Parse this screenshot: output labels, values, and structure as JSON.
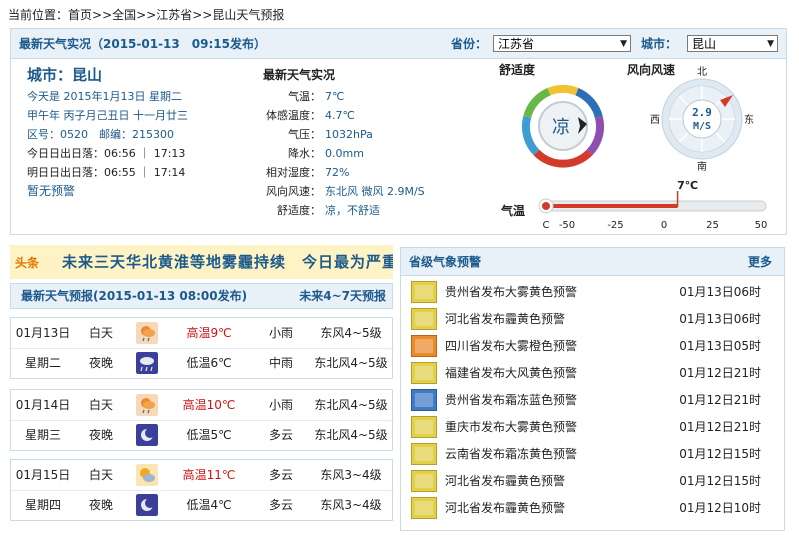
{
  "breadcrumb": {
    "prefix": "当前位置：",
    "items": [
      "首页",
      "全国",
      "江苏省",
      "昆山天气预报"
    ],
    "separator": ">>"
  },
  "observation_bar": {
    "title": "最新天气实况（2015-01-13　09:15发布）",
    "province_label": "省份：",
    "province_value": "江苏省",
    "city_label": "城市：",
    "city_value": "昆山"
  },
  "city_info": {
    "name": "城市：昆山",
    "today": "今天是 2015年1月13日 星期二",
    "lunar": "甲午年 丙子月己丑日 十一月廿三",
    "codes": "区号：0520　邮编：215300",
    "today_sun": "今日日出日落：06:56 ｜ 17:13",
    "tomorrow_sun": "明日日出日落：06:55 ｜ 17:14",
    "warning": "暂无预警"
  },
  "observation": {
    "title": "最新天气实况",
    "rows": [
      {
        "key": "气温：",
        "value": "7℃"
      },
      {
        "key": "体感温度：",
        "value": "4.7℃"
      },
      {
        "key": "气压：",
        "value": "1032hPa"
      },
      {
        "key": "降水：",
        "value": "0.0mm"
      },
      {
        "key": "相对湿度：",
        "value": "72%"
      },
      {
        "key": "风向风速：",
        "value": "东北风 微风 2.9M/S"
      },
      {
        "key": "舒适度：",
        "value": "凉，不舒适"
      }
    ]
  },
  "comfort_gauge": {
    "title": "舒适度",
    "center": "凉"
  },
  "wind_gauge": {
    "title": "风向风速",
    "speed": "2.9",
    "unit": "M/S",
    "north": "北",
    "south": "南",
    "east": "东",
    "west": "西"
  },
  "temp_gauge": {
    "label": "气温",
    "value_label": "7℃",
    "value": 7,
    "min": -50,
    "max": 50,
    "ticks": [
      "C",
      "-50",
      "-25",
      "0",
      "25",
      "50"
    ]
  },
  "headline": {
    "tag": "头条",
    "text": "未来三天华北黄淮等地雾霾持续　今日最为严重"
  },
  "forecast": {
    "title": "最新天气预报(2015-01-13 08:00发布)",
    "link": "未来4~7天预报",
    "days": [
      {
        "date": "01月13日",
        "weekday": "星期二",
        "day": {
          "tod": "白天",
          "icon": "light-rain-icon",
          "temp": "高温9℃",
          "wx": "小雨",
          "wind": "东风4~5级"
        },
        "night": {
          "tod": "夜晚",
          "icon": "moderate-rain-icon",
          "temp": "低温6℃",
          "wx": "中雨",
          "wind": "东北风4~5级"
        }
      },
      {
        "date": "01月14日",
        "weekday": "星期三",
        "day": {
          "tod": "白天",
          "icon": "light-rain-icon",
          "temp": "高温10℃",
          "wx": "小雨",
          "wind": "东北风4~5级"
        },
        "night": {
          "tod": "夜晚",
          "icon": "cloudy-night-icon",
          "temp": "低温5℃",
          "wx": "多云",
          "wind": "东北风4~5级"
        }
      },
      {
        "date": "01月15日",
        "weekday": "星期四",
        "day": {
          "tod": "白天",
          "icon": "partly-cloudy-icon",
          "temp": "高温11℃",
          "wx": "多云",
          "wind": "东风3~4级"
        },
        "night": {
          "tod": "夜晚",
          "icon": "cloudy-night-icon",
          "temp": "低温4℃",
          "wx": "多云",
          "wind": "东风3~4级"
        }
      }
    ]
  },
  "warnings": {
    "title": "省级气象预警",
    "more": "更多",
    "items": [
      {
        "text": "贵州省发布大雾黄色预警",
        "time": "01月13日06时",
        "level": "yellow"
      },
      {
        "text": "河北省发布霾黄色预警",
        "time": "01月13日06时",
        "level": "yellow"
      },
      {
        "text": "四川省发布大雾橙色预警",
        "time": "01月13日05时",
        "level": "orange"
      },
      {
        "text": "福建省发布大风黄色预警",
        "time": "01月12日21时",
        "level": "yellow"
      },
      {
        "text": "贵州省发布霜冻蓝色预警",
        "time": "01月12日21时",
        "level": "blue"
      },
      {
        "text": "重庆市发布大雾黄色预警",
        "time": "01月12日21时",
        "level": "yellow"
      },
      {
        "text": "云南省发布霜冻黄色预警",
        "time": "01月12日15时",
        "level": "yellow"
      },
      {
        "text": "河北省发布霾黄色预警",
        "time": "01月12日15时",
        "level": "yellow"
      },
      {
        "text": "河北省发布霾黄色预警",
        "time": "01月12日10时",
        "level": "yellow"
      }
    ]
  },
  "colors": {
    "accent": "#1d5a8c",
    "high_temp": "#d01010",
    "headline_bg": "#fdf3c5",
    "warning_yellow": "#e2cf4a",
    "warning_orange": "#e98a2b",
    "warning_blue": "#3f7cc4"
  }
}
